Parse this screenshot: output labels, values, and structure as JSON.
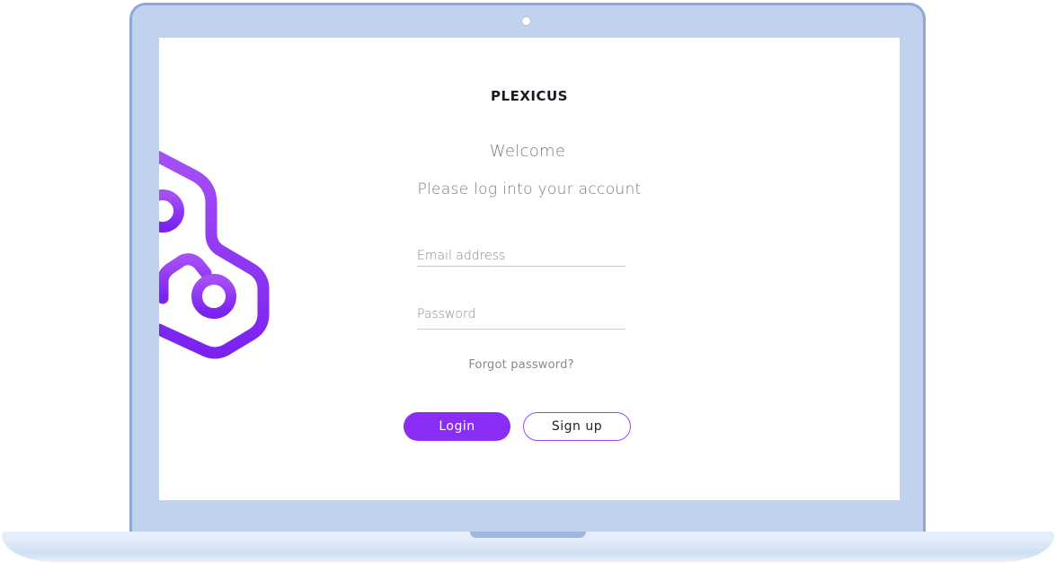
{
  "brand": "PLEXICUS",
  "welcome": "Welcome",
  "subtitle": "Please log into your account",
  "form": {
    "email_placeholder": "Email address",
    "password_placeholder": "Password",
    "forgot_label": "Forgot password?",
    "login_label": "Login",
    "signup_label": "Sign up"
  },
  "colors": {
    "accent": "#8a2df5",
    "laptop_body": "#c0d2ee",
    "laptop_border": "#8fa9d6"
  },
  "icons": {
    "logo": "plexicus-logo-mark-icon",
    "camera": "camera-dot"
  }
}
